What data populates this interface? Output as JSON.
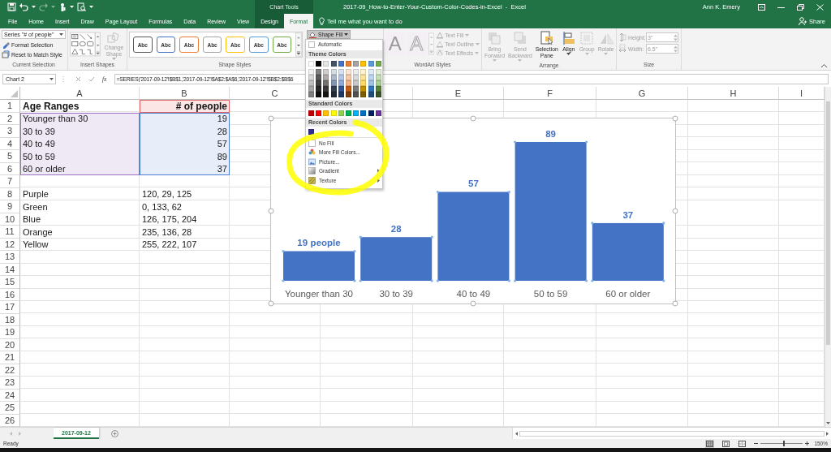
{
  "title_bar": {
    "contextual_label": "Chart Tools",
    "title": "2017-09_How-to-Enter-Your-Custom-Color-Codes-in-Excel  -  Excel",
    "user": "Ann K. Emery"
  },
  "tabs": [
    {
      "label": "File",
      "selected": false,
      "contextual": false
    },
    {
      "label": "Home",
      "selected": false,
      "contextual": false
    },
    {
      "label": "Insert",
      "selected": false,
      "contextual": false
    },
    {
      "label": "Draw",
      "selected": false,
      "contextual": false
    },
    {
      "label": "Page Layout",
      "selected": false,
      "contextual": false
    },
    {
      "label": "Formulas",
      "selected": false,
      "contextual": false
    },
    {
      "label": "Data",
      "selected": false,
      "contextual": false
    },
    {
      "label": "Review",
      "selected": false,
      "contextual": false
    },
    {
      "label": "View",
      "selected": false,
      "contextual": false
    },
    {
      "label": "Design",
      "selected": false,
      "contextual": true
    },
    {
      "label": "Format",
      "selected": true,
      "contextual": true
    }
  ],
  "tell_me": {
    "placeholder": "Tell me what you want to do"
  },
  "share": "Share",
  "ribbon": {
    "current_selection": {
      "element": "Series \"# of people\"",
      "buttons": [
        {
          "label": "Format Selection",
          "kind": "format"
        },
        {
          "label": "Reset to Match Style",
          "kind": "reset"
        }
      ],
      "label": "Current Selection"
    },
    "insert_shapes": {
      "change_shape": {
        "label": "Change Shape",
        "disabled": true
      },
      "label": "Insert Shapes"
    },
    "shape_styles": {
      "swatches": [
        {
          "text": "Abc",
          "color": "#595959"
        },
        {
          "text": "Abc",
          "color": "#4472c4"
        },
        {
          "text": "Abc",
          "color": "#ed7d31"
        },
        {
          "text": "Abc",
          "color": "#a5a5a5"
        },
        {
          "text": "Abc",
          "color": "#ffc000"
        },
        {
          "text": "Abc",
          "color": "#5b9bd5"
        },
        {
          "text": "Abc",
          "color": "#70ad47"
        }
      ],
      "shape_fill": "Shape Fill",
      "label": "Shape Styles"
    },
    "wordart_styles": {
      "gallery": [
        {
          "text": "A",
          "kind": "fill"
        },
        {
          "text": "A",
          "kind": "outline"
        }
      ],
      "buttons": [
        {
          "label": "Text Fill",
          "kind": "fill",
          "disabled": true
        },
        {
          "label": "Text Outline",
          "kind": "outline",
          "disabled": true
        },
        {
          "label": "Text Effects",
          "kind": "effects",
          "disabled": true
        }
      ],
      "label": "WordArt Styles"
    },
    "arrange": {
      "buttons": [
        {
          "label": "Bring Forward",
          "kind": "forward",
          "disabled": true,
          "dropdown": true
        },
        {
          "label": "Send Backward",
          "kind": "backward",
          "disabled": true,
          "dropdown": true
        },
        {
          "label": "Selection Pane",
          "kind": "pane",
          "disabled": false,
          "dropdown": false
        },
        {
          "label": "Align",
          "kind": "align",
          "disabled": false,
          "dropdown": true
        },
        {
          "label": "Group",
          "kind": "group",
          "disabled": true,
          "dropdown": true
        },
        {
          "label": "Rotate",
          "kind": "rotate",
          "disabled": true,
          "dropdown": true
        }
      ],
      "label": "Arrange"
    },
    "size": {
      "fields": [
        {
          "label": "Height:",
          "value": "3\"",
          "kind": "height",
          "disabled": true
        },
        {
          "label": "Width:",
          "value": "6.5\"",
          "kind": "width",
          "disabled": true
        }
      ],
      "label": "Size"
    }
  },
  "formula_bar": {
    "name_box": "Chart 2",
    "function_button": "fx",
    "formula": "=SERIES('2017-09-12'!$B$1,'2017-09-12'!$A$2:$A$6,'2017-09-12'!$B$2:$B$6"
  },
  "sheet": {
    "columns": [
      {
        "label": "A"
      },
      {
        "label": "B"
      },
      {
        "label": "C"
      },
      {},
      {
        "label": "E"
      },
      {
        "label": "F"
      },
      {
        "label": "G"
      },
      {
        "label": "H"
      },
      {
        "label": "I"
      }
    ],
    "rows": [
      {
        "number": "1",
        "cells": [
          {
            "text": "Age Ranges",
            "bold": true
          },
          {
            "text": "# of people",
            "bold": true,
            "right_aligned": true,
            "kind": "name"
          }
        ]
      },
      {
        "number": "2",
        "cells": [
          {
            "text": "Younger than 30",
            "kind": "category"
          },
          {
            "text": "19",
            "right_aligned": true,
            "kind": "values"
          }
        ]
      },
      {
        "number": "3",
        "cells": [
          {
            "text": "30 to 39",
            "kind": "category"
          },
          {
            "text": "28",
            "right_aligned": true,
            "kind": "values"
          }
        ]
      },
      {
        "number": "4",
        "cells": [
          {
            "text": "40 to 49",
            "kind": "category"
          },
          {
            "text": "57",
            "right_aligned": true,
            "kind": "values"
          }
        ]
      },
      {
        "number": "5",
        "cells": [
          {
            "text": "50 to 59",
            "kind": "category"
          },
          {
            "text": "89",
            "right_aligned": true,
            "kind": "values"
          }
        ]
      },
      {
        "number": "6",
        "cells": [
          {
            "text": "60 or older",
            "kind": "category"
          },
          {
            "text": "37",
            "right_aligned": true,
            "kind": "values"
          }
        ]
      },
      {
        "number": "7",
        "cells": []
      },
      {
        "number": "8",
        "cells": [
          {
            "text": "Purple"
          },
          {
            "text": "120, 29, 125"
          }
        ]
      },
      {
        "number": "9",
        "cells": [
          {
            "text": "Green"
          },
          {
            "text": "0, 133, 62"
          }
        ]
      },
      {
        "number": "10",
        "cells": [
          {
            "text": "Blue"
          },
          {
            "text": "126, 175, 204"
          }
        ]
      },
      {
        "number": "11",
        "cells": [
          {
            "text": "Orange"
          },
          {
            "text": "235, 136, 28"
          }
        ]
      },
      {
        "number": "12",
        "cells": [
          {
            "text": "Yellow"
          },
          {
            "text": "255, 222, 107"
          }
        ]
      },
      {
        "number": "13",
        "cells": []
      },
      {
        "number": "14",
        "cells": []
      },
      {
        "number": "15",
        "cells": []
      },
      {
        "number": "16",
        "cells": []
      },
      {
        "number": "17",
        "cells": []
      },
      {
        "number": "18",
        "cells": []
      },
      {
        "number": "19",
        "cells": []
      },
      {
        "number": "20",
        "cells": []
      },
      {
        "number": "21",
        "cells": []
      },
      {
        "number": "22",
        "cells": []
      },
      {
        "number": "23",
        "cells": []
      },
      {
        "number": "24",
        "cells": []
      },
      {
        "number": "25",
        "cells": []
      },
      {
        "number": "26",
        "cells": []
      }
    ]
  },
  "chart": {
    "chart_data": {
      "type": "bar",
      "categories": [
        "Younger than 30",
        "30 to 39",
        "40 to 49",
        "50 to 59",
        "60 or older"
      ],
      "series": [
        {
          "color": "#4472c4",
          "values": [
            19,
            28,
            57,
            89,
            37
          ]
        }
      ],
      "data_labels": true,
      "annotations": [
        "people"
      ]
    }
  },
  "shape_fill_menu": {
    "automatic": "Automatic",
    "sections": [
      {
        "title": "Theme Colors",
        "kind": "theme",
        "rows": [
          [
            {
              "color": "#ffffff"
            },
            {
              "color": "#000000"
            },
            {
              "color": "#e7e6e6"
            },
            {
              "color": "#44546a"
            },
            {
              "color": "#4472c4"
            },
            {
              "color": "#ed7d31"
            },
            {
              "color": "#a5a5a5"
            },
            {
              "color": "#ffc000"
            },
            {
              "color": "#5b9bd5"
            },
            {
              "color": "#70ad47"
            }
          ],
          [
            {
              "color": "#f2f2f2"
            },
            {
              "color": "#808080"
            },
            {
              "color": "#d0cece"
            },
            {
              "color": "#d6dce4"
            },
            {
              "color": "#d9e2f3"
            },
            {
              "color": "#fbe5d5"
            },
            {
              "color": "#ededed"
            },
            {
              "color": "#fff2cc"
            },
            {
              "color": "#deebf6"
            },
            {
              "color": "#e2efd9"
            }
          ],
          [
            {
              "color": "#d9d9d9"
            },
            {
              "color": "#595959"
            },
            {
              "color": "#aeaaaa"
            },
            {
              "color": "#adb9ca"
            },
            {
              "color": "#b4c6e7"
            },
            {
              "color": "#f7cbac"
            },
            {
              "color": "#dbdbdb"
            },
            {
              "color": "#ffe599"
            },
            {
              "color": "#bdd7ee"
            },
            {
              "color": "#c5e0b3"
            }
          ],
          [
            {
              "color": "#bfbfbf"
            },
            {
              "color": "#404040"
            },
            {
              "color": "#757171"
            },
            {
              "color": "#8496b0"
            },
            {
              "color": "#8eaadb"
            },
            {
              "color": "#f4b183"
            },
            {
              "color": "#c9c9c9"
            },
            {
              "color": "#ffd966"
            },
            {
              "color": "#9dc3e6"
            },
            {
              "color": "#a8d08d"
            }
          ],
          [
            {
              "color": "#a6a6a6"
            },
            {
              "color": "#262626"
            },
            {
              "color": "#3a3838"
            },
            {
              "color": "#333f4f"
            },
            {
              "color": "#2f5496"
            },
            {
              "color": "#c55a11"
            },
            {
              "color": "#7b7b7b"
            },
            {
              "color": "#bf9000"
            },
            {
              "color": "#2e75b5"
            },
            {
              "color": "#538135"
            }
          ],
          [
            {
              "color": "#808080"
            },
            {
              "color": "#0d0d0d"
            },
            {
              "color": "#161616"
            },
            {
              "color": "#222a35"
            },
            {
              "color": "#1f3864"
            },
            {
              "color": "#833c0b"
            },
            {
              "color": "#525252"
            },
            {
              "color": "#7f6000"
            },
            {
              "color": "#1f4e79"
            },
            {
              "color": "#375623"
            }
          ]
        ]
      },
      {
        "title": "Standard Colors",
        "kind": "standard",
        "rows": [
          [
            {
              "color": "#c00000"
            },
            {
              "color": "#ff0000"
            },
            {
              "color": "#ffc000"
            },
            {
              "color": "#ffff00"
            },
            {
              "color": "#92d050"
            },
            {
              "color": "#00b050"
            },
            {
              "color": "#00b0f0"
            },
            {
              "color": "#0070c0"
            },
            {
              "color": "#002060"
            },
            {
              "color": "#7030a0"
            }
          ]
        ]
      },
      {
        "title": "Recent Colors",
        "kind": "recent",
        "rows": [
          [
            {
              "color": "#2e3192"
            }
          ]
        ]
      }
    ],
    "items": [
      {
        "label": "No Fill",
        "kind": "none",
        "submenu": false
      },
      {
        "label": "More Fill Colors...",
        "kind": "palette",
        "submenu": false
      },
      {
        "label": "Picture...",
        "kind": "picture",
        "submenu": false
      },
      {
        "label": "Gradient",
        "kind": "gradient",
        "submenu": true
      },
      {
        "label": "Texture",
        "kind": "texture",
        "submenu": true
      }
    ]
  },
  "sheet_tabs": [
    {
      "label": "2017-09-12",
      "selected": true
    }
  ],
  "status_bar": {
    "text": "Ready",
    "views": [
      {
        "kind": "normal",
        "selected": true
      },
      {
        "kind": "page_layout",
        "selected": false
      },
      {
        "kind": "page_break",
        "selected": false
      }
    ],
    "zoom": {
      "label": "150%",
      "level": 0.55
    }
  }
}
